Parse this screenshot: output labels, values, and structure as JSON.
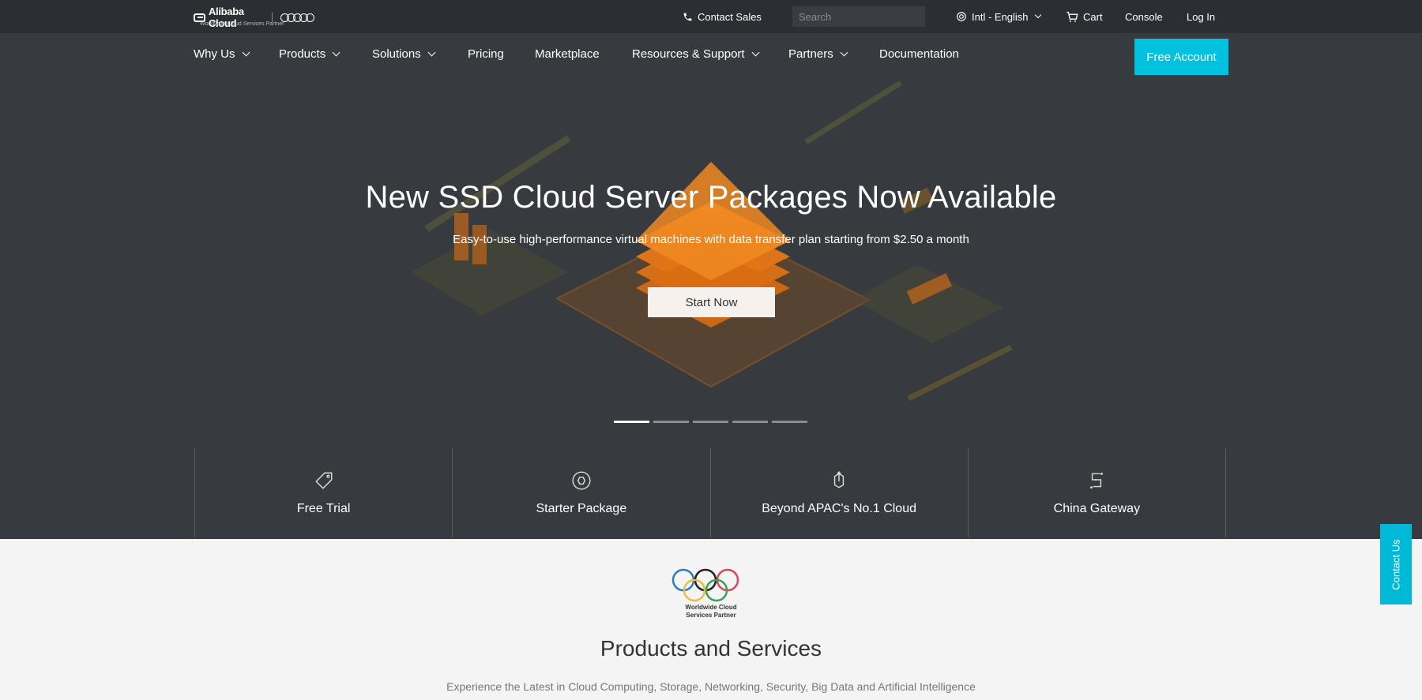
{
  "topbar": {
    "logo_text": "Alibaba Cloud",
    "logo_tagline": "Worldwide Cloud Services Partner",
    "contact_sales": "Contact Sales",
    "search_placeholder": "Search",
    "language": "Intl - English",
    "cart": "Cart",
    "console": "Console",
    "login": "Log In"
  },
  "nav": {
    "items": [
      {
        "label": "Why Us",
        "dropdown": true
      },
      {
        "label": "Products",
        "dropdown": true
      },
      {
        "label": "Solutions",
        "dropdown": true
      },
      {
        "label": "Pricing",
        "dropdown": false
      },
      {
        "label": "Marketplace",
        "dropdown": false
      },
      {
        "label": "Resources & Support",
        "dropdown": true
      },
      {
        "label": "Partners",
        "dropdown": true
      },
      {
        "label": "Documentation",
        "dropdown": false
      }
    ],
    "cta": "Free Account"
  },
  "hero": {
    "title": "New SSD Cloud Server Packages Now Available",
    "subtitle": "Easy-to-use high-performance virtual machines with data transfer plan starting from $2.50 a month",
    "button": "Start Now",
    "slides_total": 5,
    "active_slide": 1
  },
  "features": [
    {
      "label": "Free Trial",
      "icon": "tag-icon"
    },
    {
      "label": "Starter Package",
      "icon": "package-icon"
    },
    {
      "label": "Beyond APAC's No.1 Cloud",
      "icon": "upload-icon"
    },
    {
      "label": "China Gateway",
      "icon": "gateway-icon"
    }
  ],
  "partner": {
    "line1": "Worldwide Cloud",
    "line2": "Services Partner"
  },
  "products_section": {
    "title": "Products and Services",
    "subtitle": "Experience the Latest in Cloud Computing, Storage, Networking, Security, Big Data and Artificial Intelligence"
  },
  "contact_us": "Contact Us",
  "colors": {
    "accent": "#00c1de",
    "topbar": "#2b2e33",
    "nav": "#373a3f",
    "hero_orange": "#f07c1a"
  }
}
